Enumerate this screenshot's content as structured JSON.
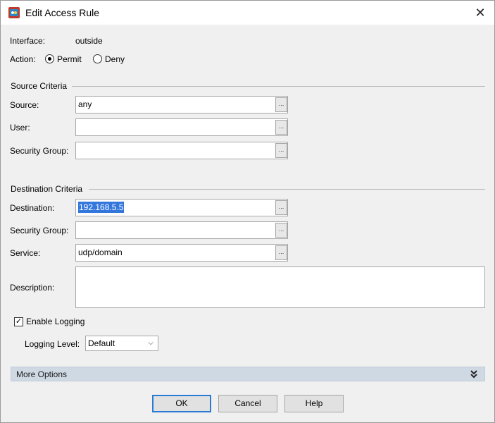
{
  "window": {
    "title": "Edit Access Rule",
    "close_symbol": "✕"
  },
  "interface": {
    "label": "Interface:",
    "value": "outside"
  },
  "action": {
    "label": "Action:",
    "permit_label": "Permit",
    "deny_label": "Deny",
    "selected": "Permit"
  },
  "source_criteria": {
    "heading": "Source Criteria",
    "source_label": "Source:",
    "source_value": "any",
    "user_label": "User:",
    "user_value": "",
    "security_group_label": "Security Group:",
    "security_group_value": "",
    "browse_symbol": "..."
  },
  "destination_criteria": {
    "heading": "Destination Criteria",
    "destination_label": "Destination:",
    "destination_value": "192.168.5.5",
    "security_group_label": "Security Group:",
    "security_group_value": "",
    "service_label": "Service:",
    "service_value": "udp/domain",
    "browse_symbol": "..."
  },
  "description": {
    "label": "Description:",
    "value": ""
  },
  "logging": {
    "enable_label": "Enable Logging",
    "enabled": true,
    "check_symbol": "✓",
    "level_label": "Logging Level:",
    "level_value": "Default",
    "chevron": "⌵"
  },
  "more_options": {
    "label": "More Options",
    "chevron": "»"
  },
  "buttons": {
    "ok": "OK",
    "cancel": "Cancel",
    "help": "Help"
  },
  "icons": {
    "app": "asdm-app-icon",
    "close": "close-icon",
    "browse": "browse-ellipsis-icon",
    "dropdown": "chevron-down-icon",
    "expand": "double-chevron-down-icon"
  }
}
